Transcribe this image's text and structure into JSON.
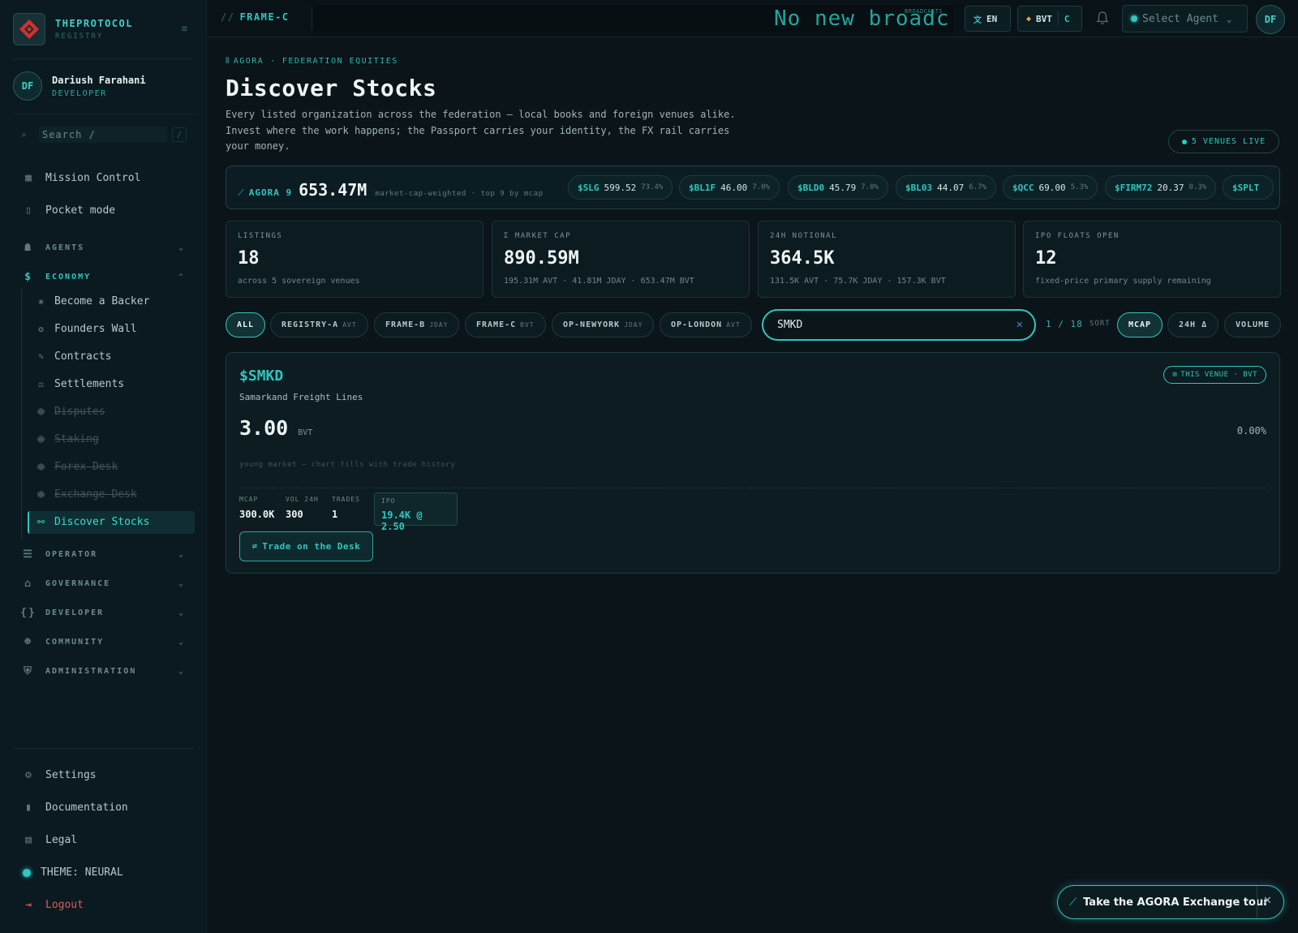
{
  "brand": {
    "name": "THEPROTOCOL",
    "sub": "REGISTRY"
  },
  "user": {
    "initials": "DF",
    "name": "Dariush Farahani",
    "role": "DEVELOPER"
  },
  "sidebar_search": {
    "placeholder": "Search  /",
    "shortcut": "/"
  },
  "nav": {
    "mission_control": "Mission Control",
    "pocket_mode": "Pocket mode",
    "agents": "AGENTS",
    "economy": "ECONOMY",
    "economy_items": [
      {
        "label": "Become a Backer"
      },
      {
        "label": "Founders Wall"
      },
      {
        "label": "Contracts"
      },
      {
        "label": "Settlements"
      },
      {
        "label": "Disputes"
      },
      {
        "label": "Staking"
      },
      {
        "label": "Forex Desk"
      },
      {
        "label": "Exchange Desk"
      },
      {
        "label": "Discover Stocks"
      }
    ],
    "operator": "OPERATOR",
    "governance": "GOVERNANCE",
    "developer": "DEVELOPER",
    "community": "COMMUNITY",
    "administration": "ADMINISTRATION",
    "settings": "Settings",
    "documentation": "Documentation",
    "legal": "Legal",
    "theme": "THEME: NEURAL",
    "logout": "Logout"
  },
  "topbar": {
    "frame": "FRAME-C",
    "broadcast": "No new broadc",
    "broadcast_tag": "BROADCASTS",
    "language": "EN",
    "currency": "BVT",
    "currency_frame": "C",
    "agent_select": "Select Agent",
    "avatar": "DF"
  },
  "page": {
    "crumb": "AGORA · FEDERATION EQUITIES",
    "title": "Discover Stocks",
    "description": "Every listed organization across the federation — local books and foreign venues alike. Invest where the work happens; the Passport carries your identity, the FX rail carries your money.",
    "venues_live": "5 VENUES LIVE"
  },
  "ticker": {
    "label": "AGORA 9",
    "value": "653.47M",
    "note": "market-cap-weighted · top 9 by mcap",
    "items": [
      {
        "sym": "$SLG",
        "price": "599.52",
        "pct": "73.4%"
      },
      {
        "sym": "$BL1F",
        "price": "46.00",
        "pct": "7.0%"
      },
      {
        "sym": "$BLD0",
        "price": "45.79",
        "pct": "7.0%"
      },
      {
        "sym": "$BL03",
        "price": "44.07",
        "pct": "6.7%"
      },
      {
        "sym": "$QCC",
        "price": "69.00",
        "pct": "5.3%"
      },
      {
        "sym": "$FIRM72",
        "price": "20.37",
        "pct": "0.3%"
      },
      {
        "sym": "$SPLT",
        "price": "",
        "pct": ""
      }
    ]
  },
  "stats": [
    {
      "label": "LISTINGS",
      "value": "18",
      "sub": "across 5 sovereign venues"
    },
    {
      "label": "Σ MARKET CAP",
      "value": "890.59M",
      "sub": "195.31M AVT · 41.81M JDAY · 653.47M BVT"
    },
    {
      "label": "24H NOTIONAL",
      "value": "364.5K",
      "sub": "131.5K AVT · 75.7K JDAY · 157.3K BVT"
    },
    {
      "label": "IPO FLOATS OPEN",
      "value": "12",
      "sub": "fixed-price primary supply remaining"
    }
  ],
  "filters": [
    {
      "label": "ALL",
      "cur": ""
    },
    {
      "label": "REGISTRY-A",
      "cur": "AVT"
    },
    {
      "label": "FRAME-B",
      "cur": "JDAY"
    },
    {
      "label": "FRAME-C",
      "cur": "BVT"
    },
    {
      "label": "OP-NEWYORK",
      "cur": "JDAY"
    },
    {
      "label": "OP-LONDON",
      "cur": "AVT"
    }
  ],
  "search": {
    "value": "SMKD"
  },
  "count": "1 / 18",
  "sort": {
    "label": "SORT",
    "options": [
      "MCAP",
      "24H Δ",
      "VOLUME"
    ]
  },
  "listing": {
    "symbol": "$SMKD",
    "name": "Samarkand Freight Lines",
    "price": "3.00",
    "currency": "BVT",
    "change": "0.00%",
    "venue_tag": "THIS VENUE · BVT",
    "chart_note": "young market — chart fills with trade history",
    "mcap_label": "MCAP",
    "mcap": "300.0K",
    "vol_label": "VOL 24H",
    "vol": "300",
    "trades_label": "TRADES",
    "trades": "1",
    "ipo_label": "IPO",
    "ipo": "19.4K @ 2.50",
    "trade_button": "Trade on the Desk"
  },
  "tour": {
    "label": "Take the AGORA Exchange tour"
  },
  "colors": {
    "accent": "#2fc6be",
    "background": "#0b1419",
    "logout": "#e05a5a",
    "logo": "#e03a3a"
  }
}
